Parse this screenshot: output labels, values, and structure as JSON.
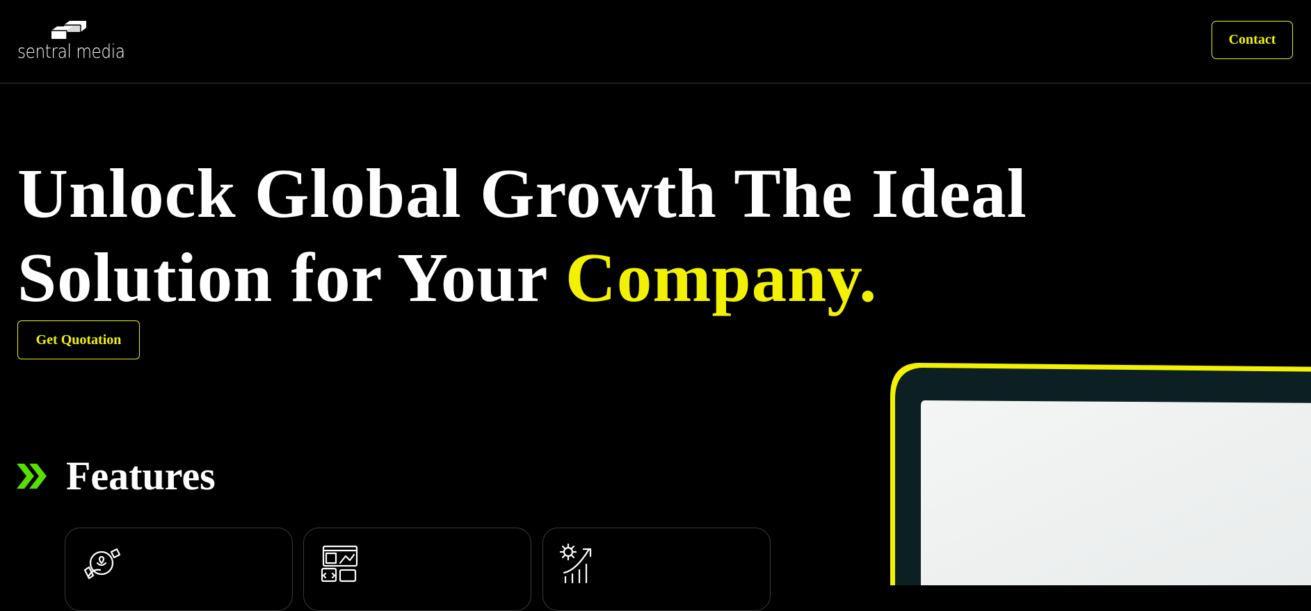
{
  "brand": {
    "name": "sentral media",
    "icon": "stacked-blocks-logo-icon"
  },
  "nav": {
    "contact_label": "Contact"
  },
  "hero": {
    "title_line1": "Unlock Global Growth The Ideal",
    "title_line2_prefix": "Solution for Your ",
    "title_line2_accent": "Company.",
    "cta_label": "Get Quotation",
    "image": "laptop-image"
  },
  "features": {
    "title": "Features",
    "icon": "double-chevron-right-icon",
    "cards": [
      {
        "icon": "hand-heart-globe-icon"
      },
      {
        "icon": "web-design-code-image-icon"
      },
      {
        "icon": "gear-growth-chart-icon"
      }
    ]
  },
  "colors": {
    "background": "#000000",
    "accent": "#f2f200",
    "features_icon": "#55e000",
    "text": "#ffffff",
    "border": "#3a3a3a"
  }
}
